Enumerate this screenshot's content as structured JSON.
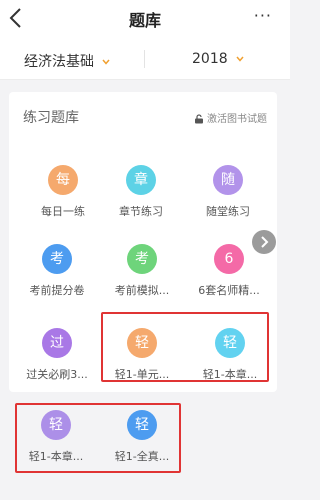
{
  "header": {
    "title": "题库",
    "more_label": "···"
  },
  "filters": {
    "subject": "经济法基础",
    "year": "2018"
  },
  "practice": {
    "title": "练习题库",
    "activate_label": "激活图书试题",
    "items": [
      {
        "label": "每日一练",
        "icon": "每",
        "color": "#f5a96d"
      },
      {
        "label": "章节练习",
        "icon": "章",
        "color": "#5dd2e6"
      },
      {
        "label": "随堂练习",
        "icon": "随",
        "color": "#b293ea"
      },
      {
        "label": "考前提分卷",
        "icon": "考",
        "color": "#4d9cf0"
      },
      {
        "label": "考前模拟...",
        "icon": "考",
        "color": "#6ed47b"
      },
      {
        "label": "6套名师精...",
        "icon": "6",
        "color": "#f46aa7"
      },
      {
        "label": "过关必刷3...",
        "icon": "过",
        "color": "#a978e6"
      },
      {
        "label": "轻1-单元...",
        "icon": "轻",
        "color": "#f5a96d"
      },
      {
        "label": "轻1-本章...",
        "icon": "轻",
        "color": "#62d2f0"
      },
      {
        "label": "轻1-本章...",
        "icon": "轻",
        "color": "#ac8fe8"
      },
      {
        "label": "轻1-全真...",
        "icon": "轻",
        "color": "#4d9cf0"
      }
    ]
  },
  "colors": {
    "accent": "#f0a030",
    "highlight": "#e03434"
  }
}
